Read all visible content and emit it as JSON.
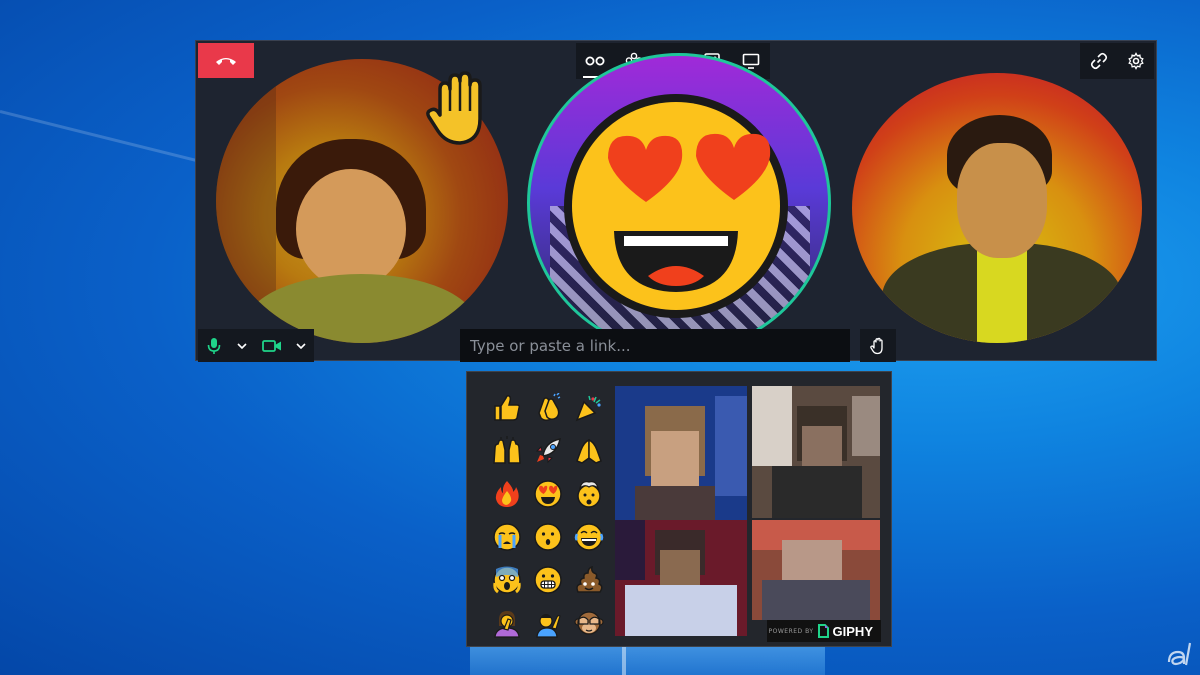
{
  "call": {
    "link_input_placeholder": "Type or paste a link...",
    "toolbar_icons": [
      "participants-icon",
      "effects-icon",
      "whiteboard-icon",
      "image-icon",
      "screen-share-icon"
    ],
    "colors": {
      "hangup": "#e9394a",
      "speaking_ring": "#1fc79a",
      "mic_active": "#1fd48a",
      "camera_active": "#1fd48a"
    }
  },
  "reactions": {
    "emojis": [
      "thumbs-up",
      "clapping-hands",
      "party-popper",
      "raising-hands",
      "rocket",
      "folded-hands",
      "fire",
      "heart-eyes",
      "exploding-head",
      "crying",
      "hushed",
      "tears-of-joy",
      "screaming",
      "grimacing",
      "pile-of-poo",
      "person-facepalming",
      "person-raising-hand",
      "see-no-evil-monkey"
    ]
  },
  "giphy": {
    "powered_by": "POWERED BY",
    "brand": "GIPHY"
  }
}
